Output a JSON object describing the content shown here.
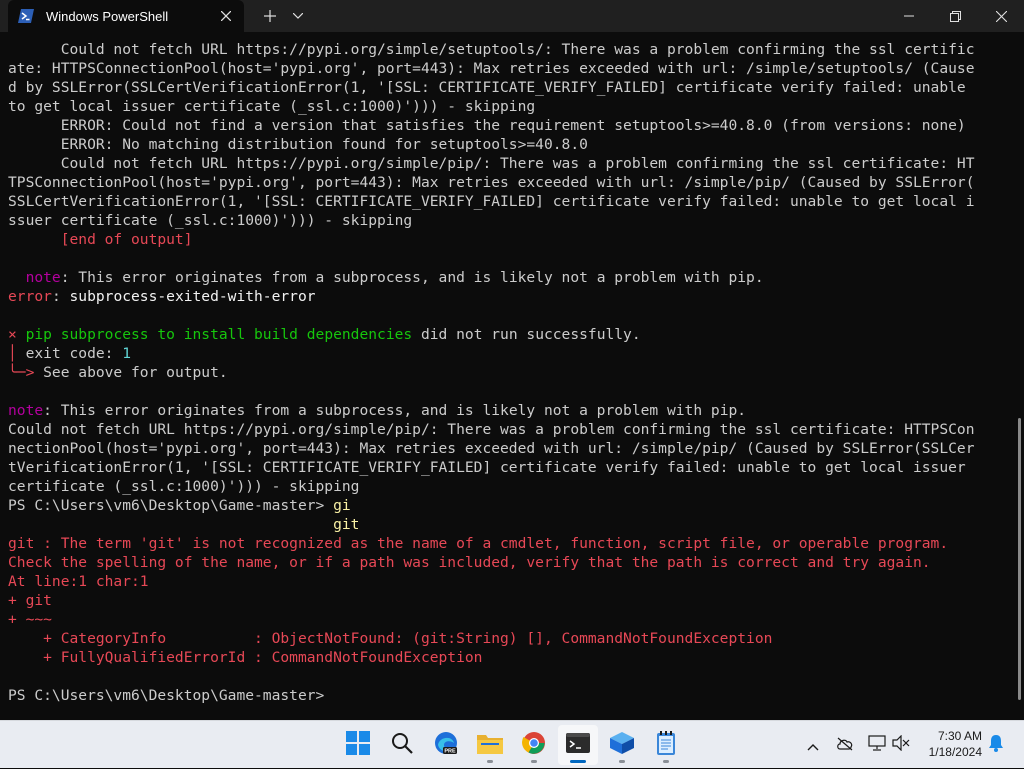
{
  "window": {
    "tab_title": "Windows PowerShell",
    "new_tab_icon": "plus-icon",
    "dropdown_icon": "chevron-down-icon",
    "minimize_icon": "minimize-icon",
    "maximize_icon": "restore-icon",
    "close_icon": "close-icon"
  },
  "colors": {
    "background": "#0c0c0c",
    "default_text": "#cccccc",
    "error": "#e74856",
    "note": "#b4009e",
    "green": "#16c60c",
    "cyan": "#61d6d6"
  },
  "terminal": {
    "lines": [
      [
        {
          "t": "      Could not fetch URL https://pypi.org/simple/setuptools/: There was a problem confirming the ssl certific",
          "c": "default"
        }
      ],
      [
        {
          "t": "ate: HTTPSConnectionPool(host='pypi.org', port=443): Max retries exceeded with url: /simple/setuptools/ (Cause",
          "c": "default"
        }
      ],
      [
        {
          "t": "d by SSLError(SSLCertVerificationError(1, '[SSL: CERTIFICATE_VERIFY_FAILED] certificate verify failed: unable",
          "c": "default"
        }
      ],
      [
        {
          "t": "to get local issuer certificate (_ssl.c:1000)'))) - skipping",
          "c": "default"
        }
      ],
      [
        {
          "t": "      ERROR: Could not find a version that satisfies the requirement setuptools>=40.8.0 (from versions: none)",
          "c": "default"
        }
      ],
      [
        {
          "t": "      ERROR: No matching distribution found for setuptools>=40.8.0",
          "c": "default"
        }
      ],
      [
        {
          "t": "      Could not fetch URL https://pypi.org/simple/pip/: There was a problem confirming the ssl certificate: HT",
          "c": "default"
        }
      ],
      [
        {
          "t": "TPSConnectionPool(host='pypi.org', port=443): Max retries exceeded with url: /simple/pip/ (Caused by SSLError(",
          "c": "default"
        }
      ],
      [
        {
          "t": "SSLCertVerificationError(1, '[SSL: CERTIFICATE_VERIFY_FAILED] certificate verify failed: unable to get local i",
          "c": "default"
        }
      ],
      [
        {
          "t": "ssuer certificate (_ssl.c:1000)'))) - skipping",
          "c": "default"
        }
      ],
      [
        {
          "t": "      [end of output]",
          "c": "red"
        }
      ],
      [
        {
          "t": "",
          "c": "default"
        }
      ],
      [
        {
          "t": "  ",
          "c": "default"
        },
        {
          "t": "note",
          "c": "magenta"
        },
        {
          "t": ": This error originates from a subprocess, and is likely not a problem with pip.",
          "c": "default"
        }
      ],
      [
        {
          "t": "error",
          "c": "red"
        },
        {
          "t": ": ",
          "c": "default"
        },
        {
          "t": "subprocess-exited-with-error",
          "c": "white"
        }
      ],
      [
        {
          "t": "",
          "c": "default"
        }
      ],
      [
        {
          "t": "×",
          "c": "red"
        },
        {
          "t": " pip subprocess to install build dependencies",
          "c": "green"
        },
        {
          "t": " did not run successfully.",
          "c": "default"
        }
      ],
      [
        {
          "t": "│",
          "c": "red"
        },
        {
          "t": " exit code: ",
          "c": "default"
        },
        {
          "t": "1",
          "c": "cyan"
        }
      ],
      [
        {
          "t": "╰─>",
          "c": "red"
        },
        {
          "t": " See above for output.",
          "c": "default"
        }
      ],
      [
        {
          "t": "",
          "c": "default"
        }
      ],
      [
        {
          "t": "note",
          "c": "magenta"
        },
        {
          "t": ": This error originates from a subprocess, and is likely not a problem with pip.",
          "c": "default"
        }
      ],
      [
        {
          "t": "Could not fetch URL https://pypi.org/simple/pip/: There was a problem confirming the ssl certificate: HTTPSCon",
          "c": "default"
        }
      ],
      [
        {
          "t": "nectionPool(host='pypi.org', port=443): Max retries exceeded with url: /simple/pip/ (Caused by SSLError(SSLCer",
          "c": "default"
        }
      ],
      [
        {
          "t": "tVerificationError(1, '[SSL: CERTIFICATE_VERIFY_FAILED] certificate verify failed: unable to get local issuer",
          "c": "default"
        }
      ],
      [
        {
          "t": "certificate (_ssl.c:1000)'))) - skipping",
          "c": "default"
        }
      ],
      [
        {
          "t": "PS C:\\Users\\vm6\\Desktop\\Game-master> ",
          "c": "default"
        },
        {
          "t": "gi",
          "c": "yellow"
        }
      ],
      [
        {
          "t": "                                     ",
          "c": "default"
        },
        {
          "t": "git",
          "c": "yellow"
        }
      ],
      [
        {
          "t": "git : The term 'git' is not recognized as the name of a cmdlet, function, script file, or operable program.",
          "c": "red"
        }
      ],
      [
        {
          "t": "Check the spelling of the name, or if a path was included, verify that the path is correct and try again.",
          "c": "red"
        }
      ],
      [
        {
          "t": "At line:1 char:1",
          "c": "red"
        }
      ],
      [
        {
          "t": "+ git",
          "c": "red"
        }
      ],
      [
        {
          "t": "+ ~~~",
          "c": "red"
        }
      ],
      [
        {
          "t": "    + CategoryInfo          : ObjectNotFound: (git:String) [], CommandNotFoundException",
          "c": "red"
        }
      ],
      [
        {
          "t": "    + FullyQualifiedErrorId : CommandNotFoundException",
          "c": "red"
        }
      ],
      [
        {
          "t": "",
          "c": "default"
        }
      ],
      [
        {
          "t": "PS C:\\Users\\vm6\\Desktop\\Game-master>",
          "c": "default"
        }
      ]
    ]
  },
  "taskbar": {
    "apps": [
      {
        "name": "start-button",
        "icon": "windows-icon"
      },
      {
        "name": "search-button",
        "icon": "search-icon"
      },
      {
        "name": "edge-beta-button",
        "icon": "edge-icon",
        "badge": "PRE"
      },
      {
        "name": "file-explorer-button",
        "icon": "folder-icon"
      },
      {
        "name": "chrome-button",
        "icon": "chrome-icon"
      },
      {
        "name": "terminal-button",
        "icon": "terminal-icon"
      },
      {
        "name": "vscode-app-button",
        "icon": "cube-icon"
      },
      {
        "name": "notepad-button",
        "icon": "notepad-icon"
      }
    ],
    "time": "7:30 AM",
    "date": "1/18/2024"
  }
}
